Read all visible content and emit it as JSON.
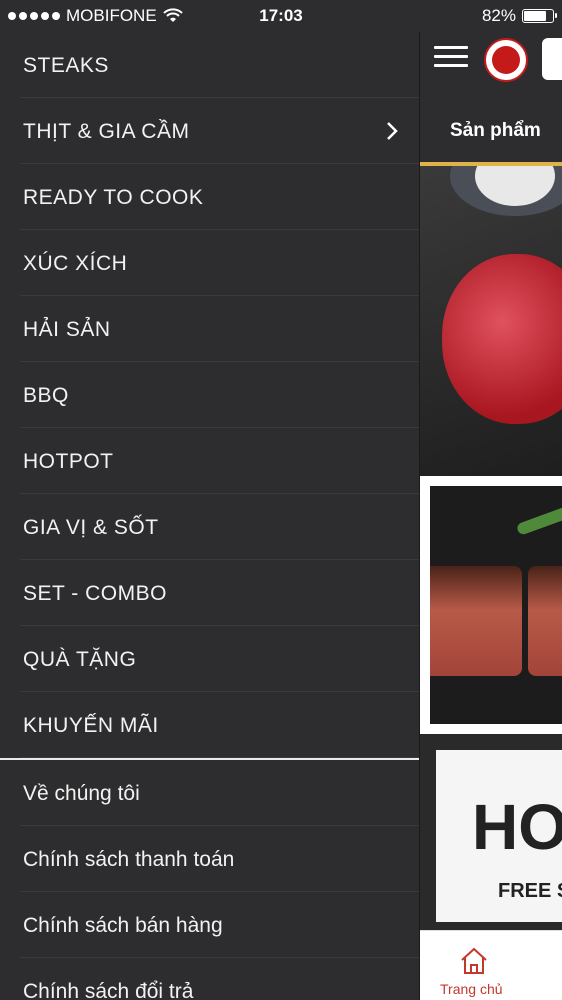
{
  "status_bar": {
    "carrier": "MOBIFONE",
    "time": "17:03",
    "battery": "82%",
    "battery_level": 0.82
  },
  "drawer": {
    "categories": [
      {
        "label": "STEAKS",
        "has_submenu": false
      },
      {
        "label": "THỊT & GIA CẦM",
        "has_submenu": true
      },
      {
        "label": "READY TO COOK",
        "has_submenu": false
      },
      {
        "label": "XÚC XÍCH",
        "has_submenu": false
      },
      {
        "label": "HẢI SẢN",
        "has_submenu": false
      },
      {
        "label": "BBQ",
        "has_submenu": false
      },
      {
        "label": "HOTPOT",
        "has_submenu": false
      },
      {
        "label": "GIA VỊ & SỐT",
        "has_submenu": false
      },
      {
        "label": "SET - COMBO",
        "has_submenu": false
      },
      {
        "label": "QUÀ TẶNG",
        "has_submenu": false
      },
      {
        "label": "KHUYẾN MÃI",
        "has_submenu": false
      }
    ],
    "info_links": [
      {
        "label": "Về chúng tôi"
      },
      {
        "label": "Chính sách thanh toán"
      },
      {
        "label": "Chính sách bán hàng"
      },
      {
        "label": "Chính sách đổi trả"
      }
    ]
  },
  "content": {
    "tab_label": "Sản phẩm",
    "banner_hot_text": "HOI",
    "banner_free_text": "FREE S",
    "bottom_nav": {
      "home_label": "Trang chủ"
    }
  },
  "colors": {
    "drawer_bg": "#2d2d2f",
    "accent_gold": "#e0b24a",
    "brand_red": "#c41a1a"
  }
}
